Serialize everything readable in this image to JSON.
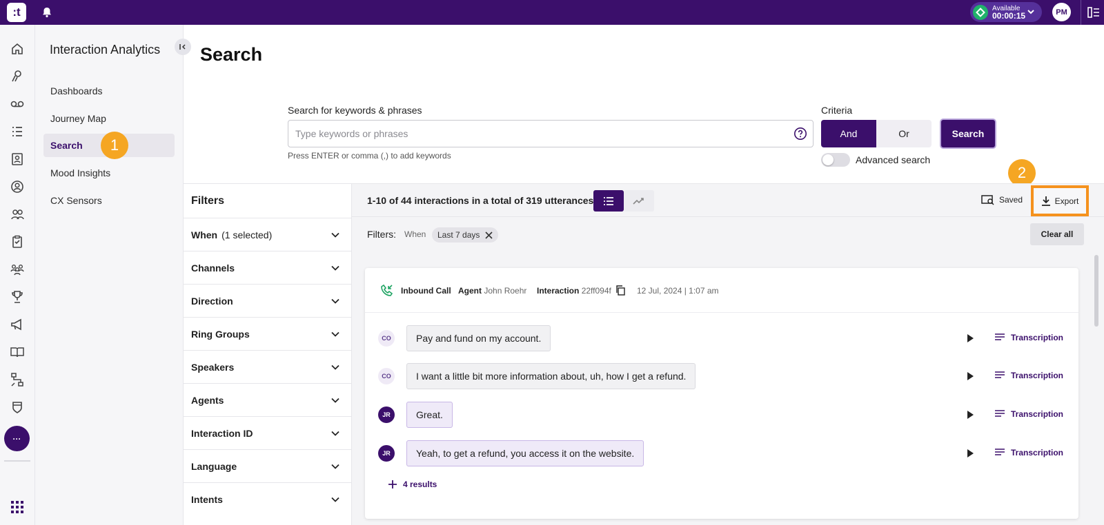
{
  "topbar": {
    "logo": ":t",
    "status_label": "Available",
    "status_timer": "00:00:15",
    "user_initials": "PM",
    "colors": {
      "bar": "#3b0f6b",
      "available": "#20b26b"
    }
  },
  "rail": {
    "icons": [
      "home-icon",
      "journey-icon",
      "voicemail-icon",
      "list-icon",
      "contacts-icon",
      "agent-icon",
      "team-icon",
      "clipboard-icon",
      "groups-icon",
      "trophy-icon",
      "megaphone-icon",
      "book-icon",
      "flow-icon",
      "shield-icon"
    ],
    "more_label": "···"
  },
  "secnav": {
    "title": "Interaction Analytics",
    "items": [
      {
        "label": "Dashboards"
      },
      {
        "label": "Journey Map"
      },
      {
        "label": "Search",
        "active": true
      },
      {
        "label": "Mood Insights"
      },
      {
        "label": "CX Sensors"
      }
    ]
  },
  "annotations": {
    "badge1": "1",
    "badge2": "2",
    "color": "#f5a623"
  },
  "page": {
    "title": "Search"
  },
  "search": {
    "label": "Search for keywords & phrases",
    "placeholder": "Type keywords or phrases",
    "hint": "Press ENTER or comma (,) to add keywords",
    "criteria_label": "Criteria",
    "and_label": "And",
    "or_label": "Or",
    "button_label": "Search",
    "advanced_label": "Advanced search"
  },
  "filters": {
    "title": "Filters",
    "when_label": "When",
    "when_selected": "(1 selected)",
    "rows": [
      "Channels",
      "Direction",
      "Ring Groups",
      "Speakers",
      "Agents",
      "Interaction ID",
      "Language",
      "Intents"
    ]
  },
  "results": {
    "count_text": "1-10 of 44 interactions in a total of 319 utterances",
    "saved_label": "Saved",
    "export_label": "Export",
    "filters_label": "Filters:",
    "filter_when": "When",
    "filter_chip": "Last 7 days",
    "clear_all": "Clear all"
  },
  "interaction": {
    "type": "Inbound Call",
    "agent_label": "Agent",
    "agent_name": "John Roehr",
    "interaction_label": "Interaction",
    "interaction_id": "22ff094f",
    "datetime": "12 Jul, 2024 | 1:07 am",
    "utterances": [
      {
        "speaker": "CO",
        "text": "Pay and fund on my account."
      },
      {
        "speaker": "CO",
        "text": "I want a little bit more information about, uh, how I get a refund."
      },
      {
        "speaker": "JR",
        "text": "Great."
      },
      {
        "speaker": "JR",
        "text": "Yeah, to get a refund, you access it on the website."
      }
    ],
    "transcription_label": "Transcription",
    "more_results": "4 results"
  }
}
